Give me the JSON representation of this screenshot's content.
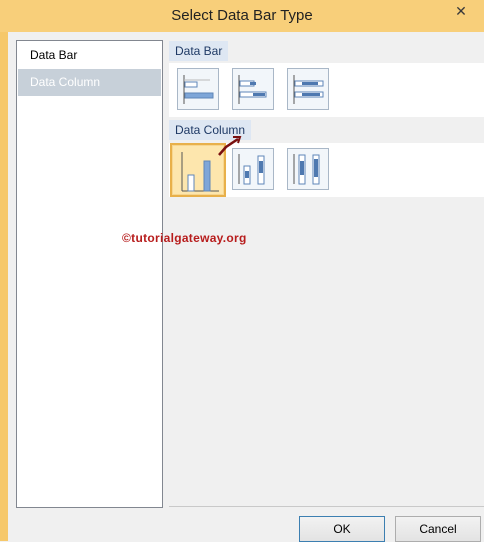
{
  "window": {
    "title": "Select Data Bar Type",
    "close_glyph": "✕"
  },
  "left_panel": {
    "items": [
      {
        "label": "Data Bar",
        "selected": false
      },
      {
        "label": "Data Column",
        "selected": true
      }
    ]
  },
  "sections": [
    {
      "header": "Data Bar",
      "tiles": [
        "data-bar-type-1",
        "data-bar-type-2",
        "data-bar-type-3"
      ]
    },
    {
      "header": "Data Column",
      "tiles": [
        "data-column-type-1",
        "data-column-type-2",
        "data-column-type-3"
      ],
      "selected_index": 0
    }
  ],
  "watermark": "©tutorialgateway.org",
  "buttons": {
    "ok": "OK",
    "cancel": "Cancel"
  },
  "colors": {
    "accent": "#3c7fb1",
    "selection": "#e8b04a",
    "header_bg": "#dee7f3",
    "watermark": "#b71c1c"
  }
}
